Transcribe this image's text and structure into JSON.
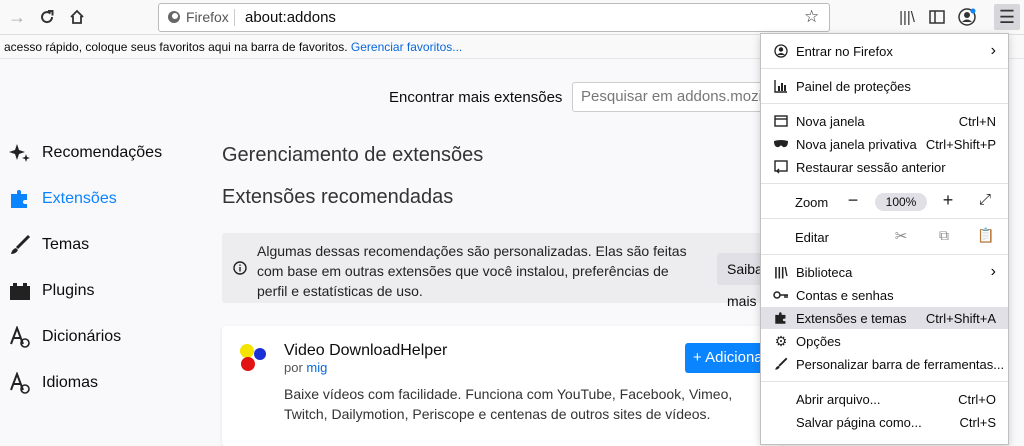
{
  "urlbar": {
    "identity": "Firefox",
    "url": "about:addons"
  },
  "bookmarks": {
    "text": "acesso rápido, coloque seus favoritos aqui na barra de favoritos.",
    "link": "Gerenciar favoritos..."
  },
  "search": {
    "label": "Encontrar mais extensões",
    "placeholder": "Pesquisar em addons.mozilla.org"
  },
  "sidebar": {
    "items": [
      {
        "label": "Recomendações",
        "icon": "sparkles-icon"
      },
      {
        "label": "Extensões",
        "icon": "puzzle-icon"
      },
      {
        "label": "Temas",
        "icon": "brush-icon"
      },
      {
        "label": "Plugins",
        "icon": "plugin-icon"
      },
      {
        "label": "Dicionários",
        "icon": "dictionary-icon"
      },
      {
        "label": "Idiomas",
        "icon": "language-icon"
      }
    ]
  },
  "main": {
    "title": "Gerenciamento de extensões",
    "subtitle": "Extensões recomendadas",
    "notice": "Algumas dessas recomendações são personalizadas. Elas são feitas com base em outras extensões que você instalou, preferências de perfil e estatísticas de uso.",
    "notice_button": "Saiba mais",
    "card": {
      "name": "Video DownloadHelper",
      "by": "por",
      "author": "mig",
      "description": "Baixe vídeos com facilidade. Funciona com YouTube, Facebook, Vimeo, Twitch, Dailymotion, Periscope e centenas de outros sites de vídeos.",
      "button": "+ Adicionar ao Firefox"
    }
  },
  "menu": {
    "items": [
      {
        "label": "Entrar no Firefox",
        "icon": "account-icon",
        "key": "›"
      },
      {
        "label": "Painel de proteções",
        "icon": "dashboard-icon",
        "key": ""
      },
      {
        "label": "Nova janela",
        "icon": "window-icon",
        "key": "Ctrl+N"
      },
      {
        "label": "Nova janela privativa",
        "icon": "private-mask-icon",
        "key": "Ctrl+Shift+P"
      },
      {
        "label": "Restaurar sessão anterior",
        "icon": "restore-icon",
        "key": ""
      },
      {
        "label": "Biblioteca",
        "icon": "library-icon",
        "key": "›"
      },
      {
        "label": "Contas e senhas",
        "icon": "key-icon",
        "key": ""
      },
      {
        "label": "Extensões e temas",
        "icon": "puzzle-icon",
        "key": "Ctrl+Shift+A"
      },
      {
        "label": "Opções",
        "icon": "gear-icon",
        "key": ""
      },
      {
        "label": "Personalizar barra de ferramentas...",
        "icon": "brush-icon",
        "key": ""
      },
      {
        "label": "Abrir arquivo...",
        "icon": "",
        "key": "Ctrl+O"
      },
      {
        "label": "Salvar página como...",
        "icon": "",
        "key": "Ctrl+S"
      }
    ],
    "zoom_label": "Zoom",
    "zoom_value": "100%",
    "edit_label": "Editar"
  },
  "colors": {
    "accent": "#0a84ff",
    "highlight": "#e0e0e6"
  }
}
